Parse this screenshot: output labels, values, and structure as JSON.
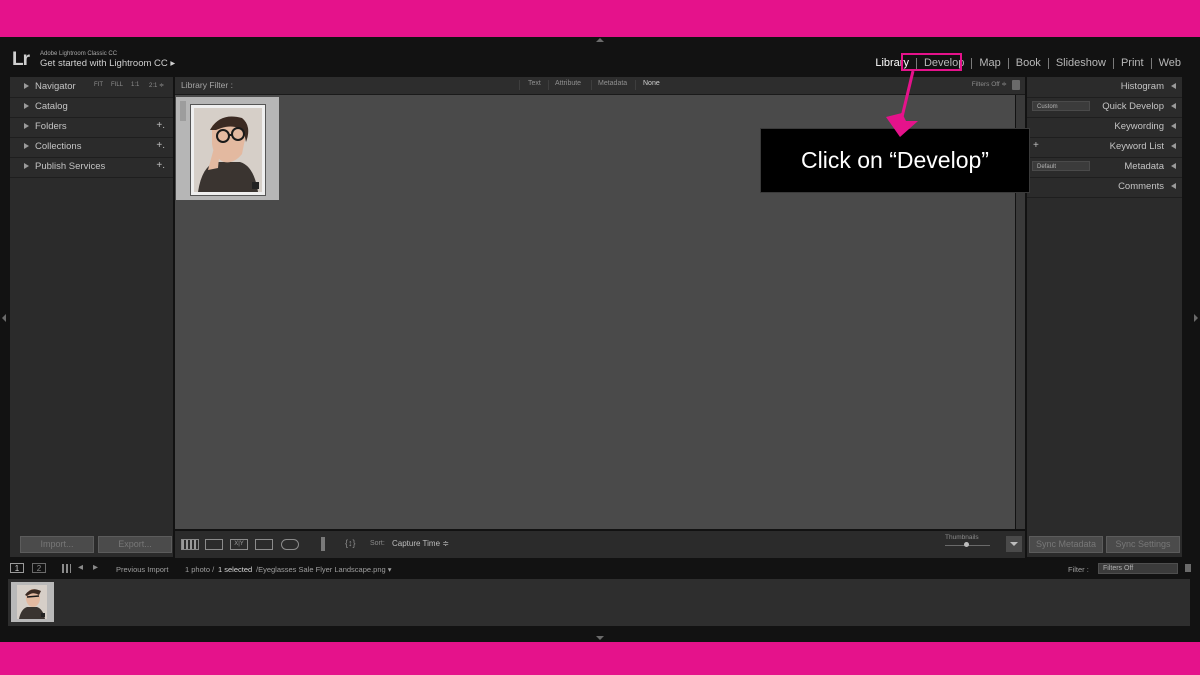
{
  "app": {
    "logo": "Lr",
    "brand": "Adobe Lightroom Classic CC",
    "get_started": "Get started with Lightroom CC ▸"
  },
  "modules": [
    {
      "label": "Library",
      "active": true
    },
    {
      "label": "Develop",
      "active": false
    },
    {
      "label": "Map",
      "active": false
    },
    {
      "label": "Book",
      "active": false
    },
    {
      "label": "Slideshow",
      "active": false
    },
    {
      "label": "Print",
      "active": false
    },
    {
      "label": "Web",
      "active": false
    }
  ],
  "left_panel": {
    "navigator": {
      "label": "Navigator",
      "zoom": [
        "FIT",
        "FILL",
        "1:1",
        "2:1 ≑"
      ]
    },
    "items": [
      {
        "label": "Catalog",
        "plus": ""
      },
      {
        "label": "Folders",
        "plus": "+."
      },
      {
        "label": "Collections",
        "plus": "+."
      },
      {
        "label": "Publish Services",
        "plus": "+."
      }
    ],
    "import_label": "Import...",
    "export_label": "Export..."
  },
  "filter_bar": {
    "label": "Library Filter :",
    "options": [
      "Text",
      "Attribute",
      "Metadata",
      "None"
    ],
    "filters_off": "Filters Off ≑"
  },
  "right_panel": {
    "items": [
      {
        "label": "Histogram",
        "select": "",
        "plus": ""
      },
      {
        "label": "Quick Develop",
        "select": "Custom",
        "plus": ""
      },
      {
        "label": "Keywording",
        "select": "",
        "plus": ""
      },
      {
        "label": "Keyword List",
        "select": "",
        "plus": "+"
      },
      {
        "label": "Metadata",
        "select": "Default",
        "plus": ""
      },
      {
        "label": "Comments",
        "select": "",
        "plus": ""
      }
    ],
    "sync_metadata": "Sync Metadata",
    "sync_settings": "Sync Settings"
  },
  "toolbar": {
    "sort_label": "Sort:",
    "sort_value": "Capture Time ≑",
    "thumbnails_label": "Thumbnails"
  },
  "filmstrip": {
    "page1": "1",
    "page2": "2",
    "source": "Previous Import",
    "count": "1 photo /",
    "selected": "1 selected",
    "filename": "/Eyeglasses Sale Flyer Landscape.png ▾",
    "filter_label": "Filter :",
    "filter_value": "Filters Off"
  },
  "callout": {
    "text": "Click on “Develop”"
  },
  "colors": {
    "accent": "#e5128b",
    "panel": "#2b2b2b",
    "grid": "#4a4a4a"
  }
}
